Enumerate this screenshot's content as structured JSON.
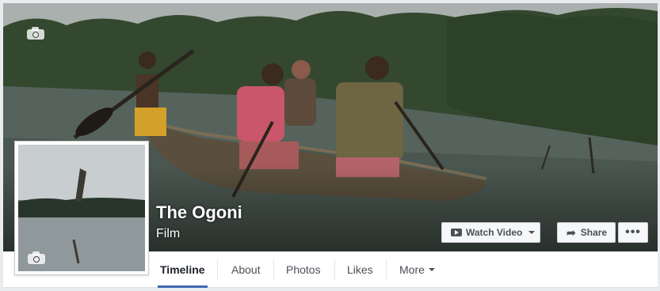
{
  "page": {
    "name": "The Ogoni",
    "category": "Film"
  },
  "cover": {
    "camera_icon": "camera-icon"
  },
  "profile": {
    "camera_icon": "camera-icon"
  },
  "actions": {
    "watch_video": "Watch Video",
    "share": "Share",
    "more": "•••"
  },
  "tabs": [
    {
      "label": "Timeline",
      "active": true
    },
    {
      "label": "About"
    },
    {
      "label": "Photos"
    },
    {
      "label": "Likes"
    },
    {
      "label": "More"
    }
  ],
  "colors": {
    "accent": "#4267b2",
    "tab_text": "#4b4f56"
  }
}
